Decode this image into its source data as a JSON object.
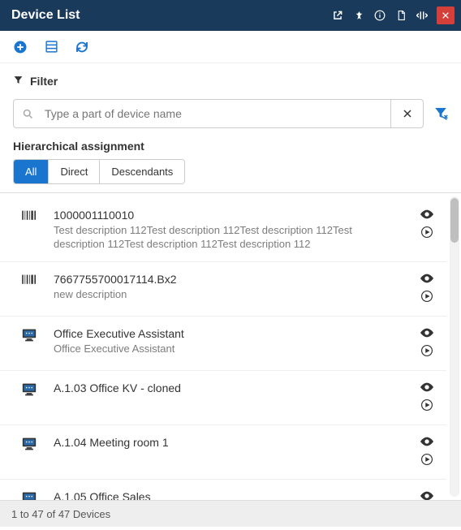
{
  "header": {
    "title": "Device List"
  },
  "filter": {
    "label": "Filter",
    "search_placeholder": "Type a part of device name",
    "hierarchical_label": "Hierarchical assignment",
    "segments": {
      "all": "All",
      "direct": "Direct",
      "descendants": "Descendants",
      "active": "all"
    }
  },
  "devices": [
    {
      "name": "1000001110010",
      "description": "Test description 112Test description 112Test description 112Test description 112Test description 112Test description 112",
      "icon": "barcode"
    },
    {
      "name": "7667755700017114.Bx2",
      "description": "new description",
      "icon": "barcode"
    },
    {
      "name": "Office Executive Assistant",
      "description": "Office Executive Assistant",
      "icon": "screen"
    },
    {
      "name": "A.1.03 Office KV - cloned",
      "description": "",
      "icon": "screen"
    },
    {
      "name": "A.1.04 Meeting room 1",
      "description": "",
      "icon": "screen"
    },
    {
      "name": "A.1.05 Office Sales",
      "description": "",
      "icon": "screen"
    }
  ],
  "footer": {
    "pagination": "1 to 47 of 47 Devices"
  },
  "colors": {
    "header_bg": "#1a3a5c",
    "accent": "#1a75cf",
    "close_bg": "#d43f3a"
  }
}
